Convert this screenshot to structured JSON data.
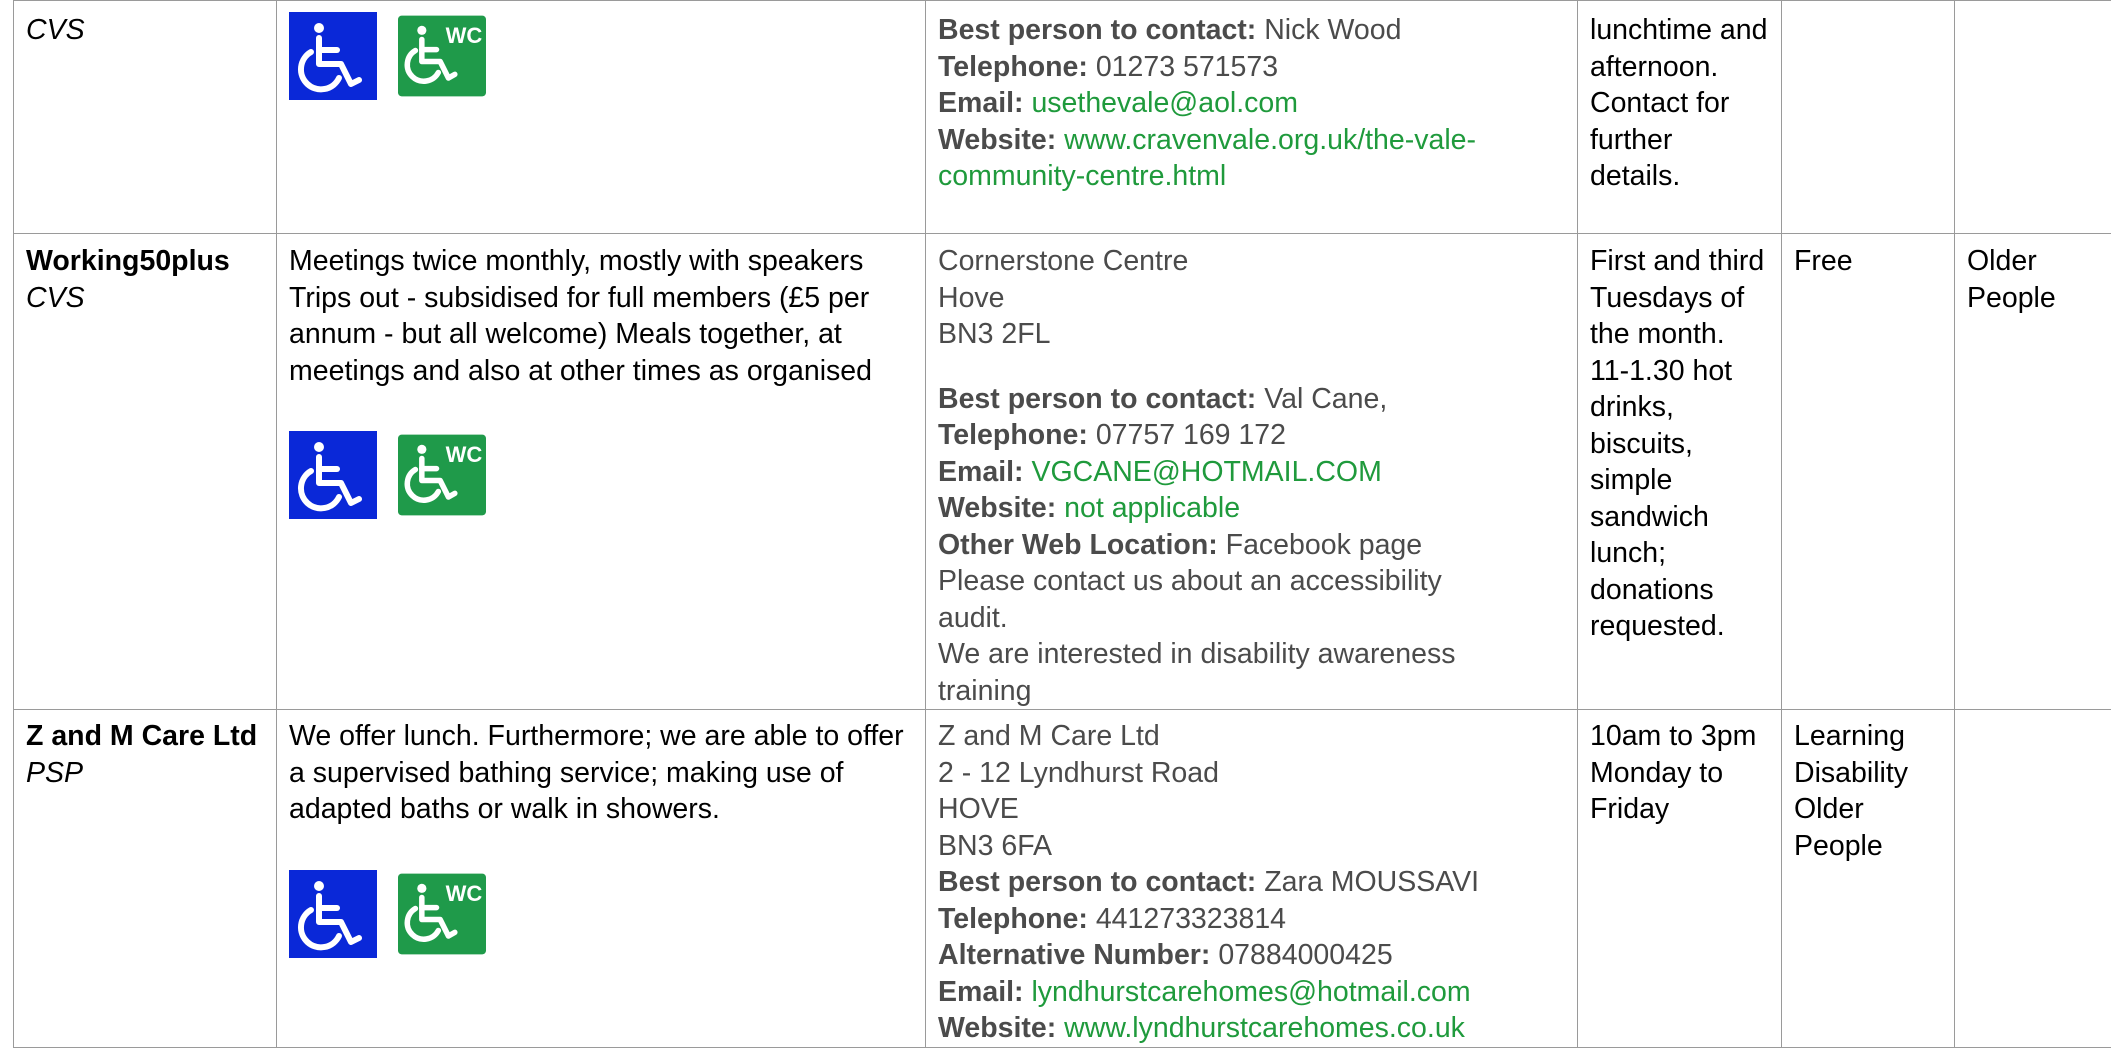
{
  "rows": [
    {
      "name": "",
      "source": "CVS",
      "description": "",
      "address_lines": [],
      "contact": {
        "best_label": "Best person to contact:",
        "best": "Nick Wood",
        "tel_label": "Telephone:",
        "tel": "01273 571573",
        "email_label": "Email:",
        "email": "usethevale@aol.com",
        "web_label": "Website:",
        "web_line1": "www.cravenvale.org.uk/the-vale-",
        "web_line2": "community-centre.html"
      },
      "times": "lunchtime and afternoon. Contact for further details.",
      "cost": "",
      "group": ""
    },
    {
      "name": "Working50plus",
      "source": "CVS",
      "description": "Meetings twice monthly, mostly with speakers Trips out - subsidised for full members (£5 per annum - but all welcome) Meals together, at meetings and also at other times as organised",
      "address_lines": [
        "Cornerstone Centre",
        "Hove",
        "BN3 2FL"
      ],
      "contact": {
        "best_label": "Best person to contact:",
        "best": "Val Cane,",
        "tel_label": "Telephone:",
        "tel": "07757 169 172",
        "email_label": "Email:",
        "email": "VGCANE@HOTMAIL.COM",
        "web_label": "Website:",
        "web": "not applicable",
        "other_label": "Other Web Location:",
        "other": "Facebook page",
        "note1_l1": "Please contact us about an accessibility",
        "note1_l2": "audit.",
        "note2_l1": "We are interested in disability awareness",
        "note2_l2": "training"
      },
      "times": "First and third Tuesdays of the month. 11-1.30 hot drinks, biscuits, simple sandwich lunch; donations requested.",
      "cost": "Free",
      "group": "Older People"
    },
    {
      "name": "Z and M Care Ltd",
      "source": "PSP",
      "description": "We offer lunch. Furthermore; we are able to offer a supervised bathing service; making use of adapted baths or walk in showers.",
      "address_lines": [
        "Z and M Care Ltd",
        "2 - 12 Lyndhurst Road",
        "HOVE",
        "BN3 6FA"
      ],
      "contact": {
        "best_label": "Best person to contact:",
        "best": "Zara MOUSSAVI",
        "tel_label": "Telephone:",
        "tel": "441273323814",
        "alt_label": "Alternative Number:",
        "alt": "07884000425",
        "email_label": "Email:",
        "email": "lyndhurstcarehomes@hotmail.com",
        "web_label": "Website:",
        "web": "www.lyndhurstcarehomes.co.uk"
      },
      "times": "10am to 3pm Monday to Friday",
      "cost": "Learning Disability Older People",
      "group": ""
    }
  ],
  "icons": {
    "wheelchair_color": "#0a28d8",
    "wc_color": "#1f9a4a",
    "wc_text": "WC"
  }
}
